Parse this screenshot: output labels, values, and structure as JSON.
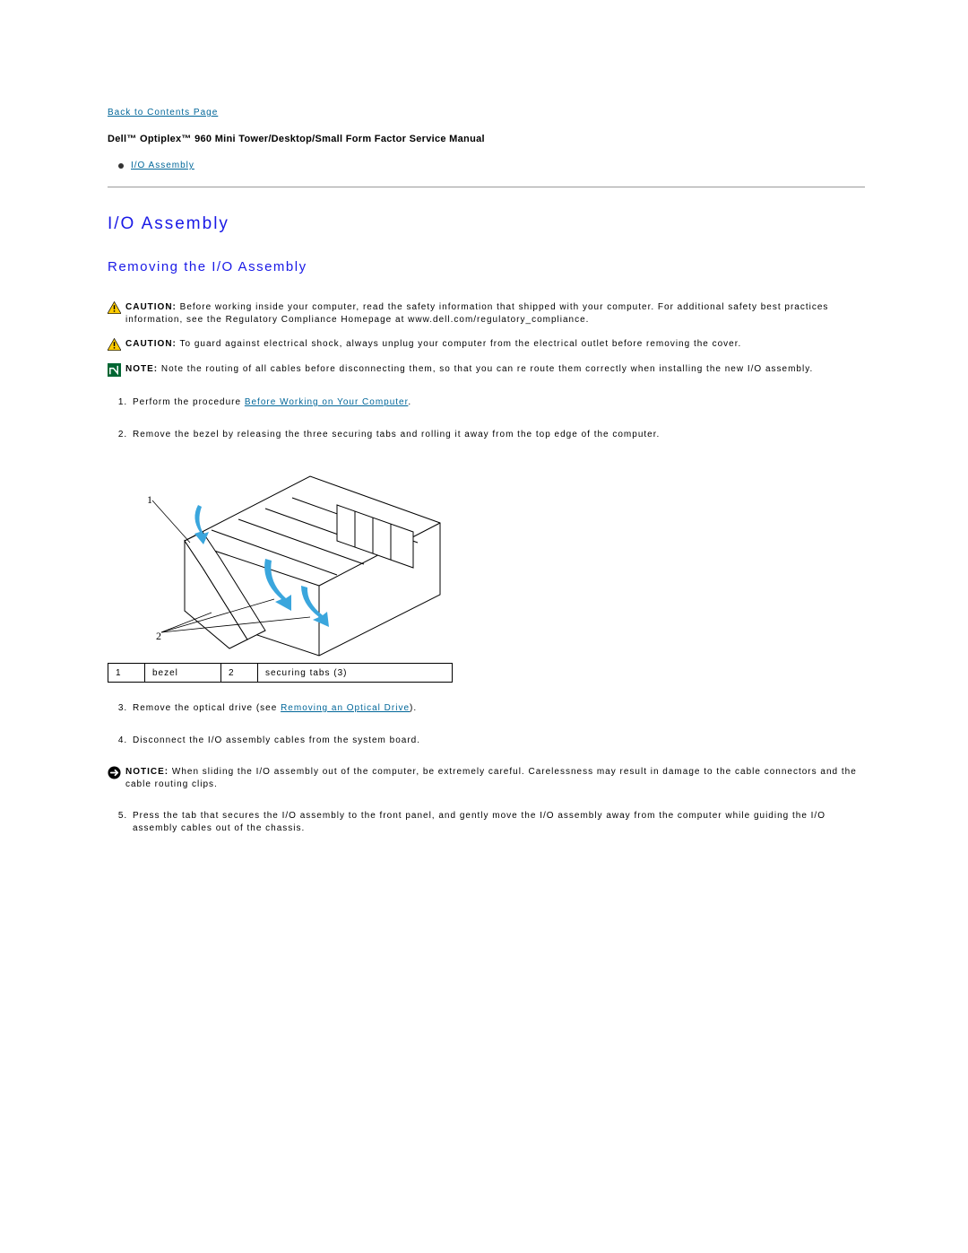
{
  "nav": {
    "back_link": "Back to Contents Page"
  },
  "doc": {
    "title": "Dell™ Optiplex™ 960 Mini Tower/Desktop/Small Form Factor Service Manual"
  },
  "toc": {
    "item1": "I/O Assembly"
  },
  "section": {
    "heading": "I/O Assembly",
    "subheading": "Removing the I/O Assembly"
  },
  "alerts": {
    "caution1_label": "CAUTION:",
    "caution1_text": " Before working inside your computer, read the safety information that shipped with your computer. For additional safety best practices information, see the Regulatory Compliance Homepage at www.dell.com/regulatory_compliance.",
    "caution2_label": "CAUTION:",
    "caution2_text": " To guard against electrical shock, always unplug your computer from the electrical outlet before removing the cover.",
    "note_label": "NOTE:",
    "note_text": " Note the routing of all cables before disconnecting them, so that you can re route them correctly when installing the new I/O assembly.",
    "notice_label": "NOTICE:",
    "notice_text": " When sliding the I/O assembly out of the computer, be extremely careful. Carelessness may result in damage to the cable connectors and the cable routing clips."
  },
  "steps": {
    "s1_pre": "Perform the procedure ",
    "s1_link": "Before Working on Your Computer",
    "s1_post": ".",
    "s2": "Remove the bezel by releasing the three securing tabs and rolling it away from the top edge of the computer.",
    "s3_pre": "Remove the optical drive (see ",
    "s3_link": "Removing an Optical Drive",
    "s3_post": ").",
    "s4": "Disconnect the I/O assembly cables from the system board.",
    "s5": "Press the tab that secures the I/O assembly to the front panel, and gently move the I/O assembly away from the computer while guiding the I/O assembly cables out of the chassis."
  },
  "legend": {
    "n1": "1",
    "l1": "bezel",
    "n2": "2",
    "l2": "securing tabs (3)"
  },
  "diagram": {
    "callout1": "1",
    "callout2": "2"
  }
}
